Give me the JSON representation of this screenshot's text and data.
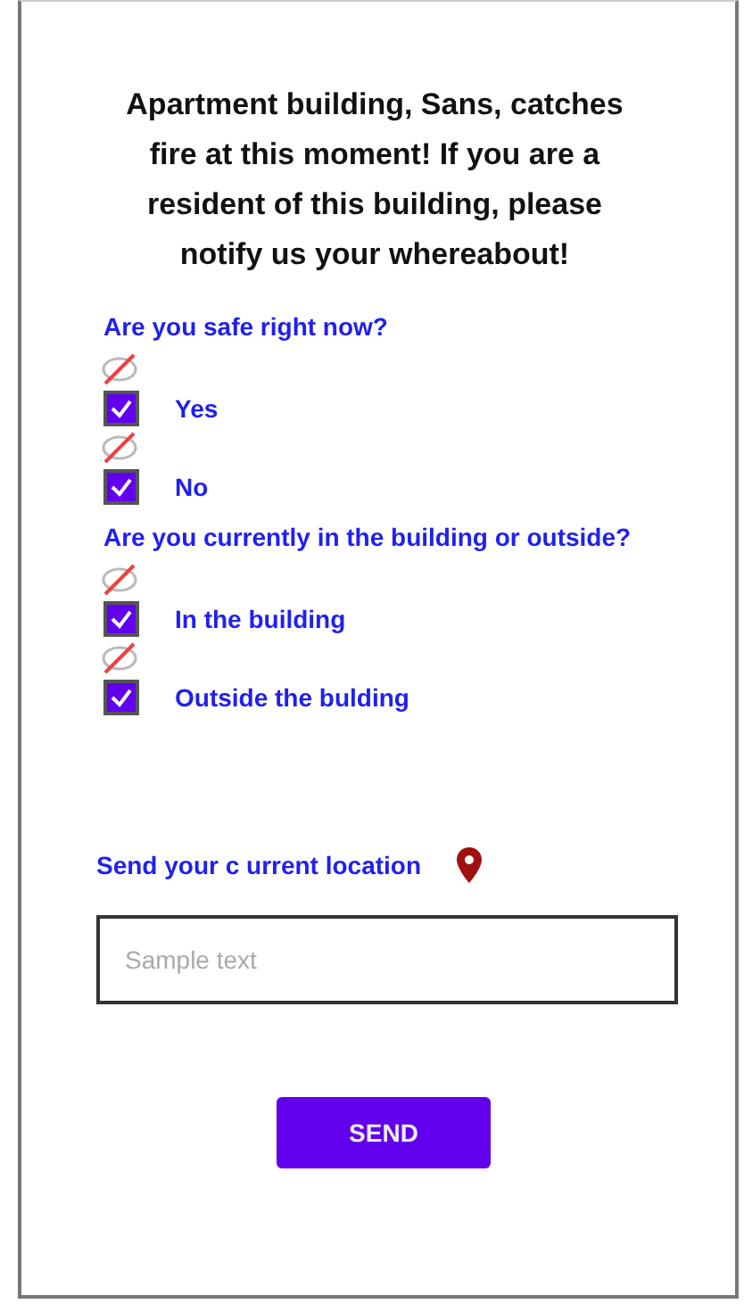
{
  "title": "Apartment building, Sans, catches fire at this moment! If you are a resident of this building, please notify us your whereabout!",
  "questions": [
    {
      "label": "Are you safe right now?",
      "options": [
        {
          "label": "Yes",
          "checked": true
        },
        {
          "label": "No",
          "checked": true
        }
      ]
    },
    {
      "label": "Are you currently in the building or outside?",
      "options": [
        {
          "label": "In the building",
          "checked": true
        },
        {
          "label": "Outside the bulding",
          "checked": true
        }
      ]
    }
  ],
  "location": {
    "label": "Send your c urrent location",
    "placeholder": "Sample text"
  },
  "button": {
    "label": "SEND"
  }
}
